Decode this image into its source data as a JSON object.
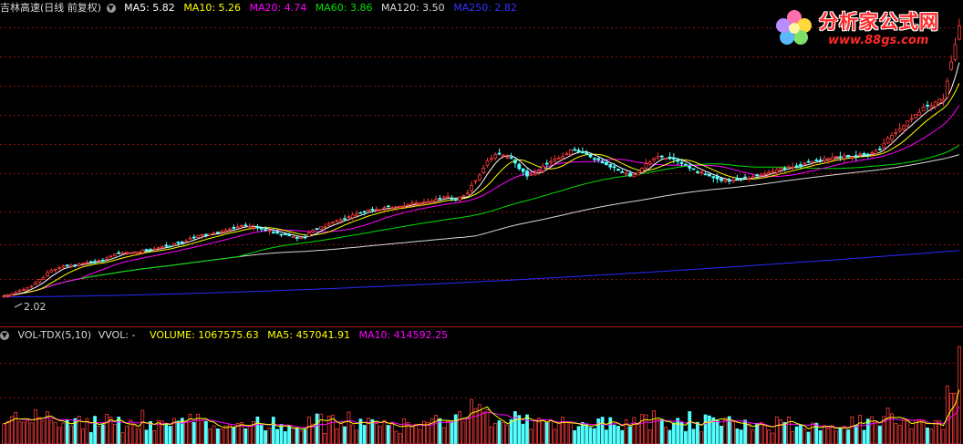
{
  "colors": {
    "up": "#ff3b3b",
    "down": "#54ffff",
    "ma5": "#ffffff",
    "ma10": "#ffff00",
    "ma20": "#ff00ff",
    "ma60": "#00e000",
    "ma120": "#d8d8d8",
    "ma250": "#2a2aff",
    "grid": "#8a1010"
  },
  "price_panel": {
    "title": "吉林高速(日线 前复权)",
    "indicators": [
      {
        "label": "MA5: 5.82",
        "color": "#ffffff"
      },
      {
        "label": "MA10: 5.26",
        "color": "#ffff00"
      },
      {
        "label": "MA20: 4.74",
        "color": "#ff00ff"
      },
      {
        "label": "MA60: 3.86",
        "color": "#00e000"
      },
      {
        "label": "MA120: 3.50",
        "color": "#d8d8d8"
      },
      {
        "label": "MA250: 2.82",
        "color": "#3333ff"
      }
    ],
    "low_marker": "2.02"
  },
  "volume_panel": {
    "title": "VOL-TDX(5,10)",
    "vvol": "VVOL: -",
    "indicators": [
      {
        "label": "VOLUME: 1067575.63",
        "color": "#ffff00"
      },
      {
        "label": "MA5: 457041.91",
        "color": "#ffffff"
      },
      {
        "label": "MA10: 414592.25",
        "color": "#ff00ff"
      }
    ]
  },
  "watermark": {
    "cn": "分析家公式网",
    "url": "www.88gs.com"
  },
  "chart_data": {
    "type": "candlestick",
    "symbol": "吉林高速",
    "period": "日线 前复权",
    "price_ylim": [
      1.8,
      7.0
    ],
    "anchors": [
      [
        0,
        2.02
      ],
      [
        8,
        2.25
      ],
      [
        18,
        2.55
      ],
      [
        26,
        2.65
      ],
      [
        32,
        2.78
      ],
      [
        44,
        2.9
      ],
      [
        52,
        3.1
      ],
      [
        62,
        3.25
      ],
      [
        72,
        3.1
      ],
      [
        76,
        3.05
      ],
      [
        82,
        3.25
      ],
      [
        92,
        3.5
      ],
      [
        100,
        3.6
      ],
      [
        112,
        3.75
      ],
      [
        118,
        3.75
      ],
      [
        126,
        4.55
      ],
      [
        132,
        4.45
      ],
      [
        138,
        4.15
      ],
      [
        150,
        4.6
      ],
      [
        166,
        4.15
      ],
      [
        174,
        4.5
      ],
      [
        190,
        4.05
      ],
      [
        200,
        4.15
      ],
      [
        208,
        4.3
      ],
      [
        218,
        4.45
      ],
      [
        230,
        4.5
      ],
      [
        238,
        4.55
      ],
      [
        246,
        5.05
      ],
      [
        252,
        5.35
      ],
      [
        258,
        5.5
      ],
      [
        260,
        6.8
      ]
    ],
    "closes": [
      2.02,
      2.02,
      2.05,
      2.08,
      2.11,
      2.13,
      2.16,
      2.19,
      2.25,
      2.31,
      2.34,
      2.43,
      2.47,
      2.49,
      2.52,
      2.55,
      2.55,
      2.56,
      2.56,
      2.58,
      2.6,
      2.61,
      2.62,
      2.63,
      2.65,
      2.64,
      2.69,
      2.72,
      2.76,
      2.78,
      2.78,
      2.79,
      2.78,
      2.79,
      2.79,
      2.83,
      2.83,
      2.84,
      2.85,
      2.87,
      2.89,
      2.91,
      2.9,
      2.95,
      2.96,
      2.97,
      2.99,
      3.04,
      3.06,
      3.09,
      3.1,
      3.1,
      3.11,
      3.13,
      3.14,
      3.16,
      3.18,
      3.2,
      3.22,
      3.24,
      3.26,
      3.27,
      3.25,
      3.23,
      3.22,
      3.2,
      3.18,
      3.18,
      3.14,
      3.13,
      3.11,
      3.1,
      3.08,
      3.07,
      3.04,
      3.05,
      3.06,
      3.13,
      3.18,
      3.21,
      3.24,
      3.24,
      3.3,
      3.33,
      3.35,
      3.37,
      3.38,
      3.42,
      3.45,
      3.47,
      3.49,
      3.51,
      3.54,
      3.54,
      3.55,
      3.55,
      3.58,
      3.6,
      3.58,
      3.6,
      3.6,
      3.61,
      3.64,
      3.66,
      3.67,
      3.66,
      3.68,
      3.69,
      3.7,
      3.73,
      3.74,
      3.77,
      3.78,
      3.74,
      3.71,
      3.77,
      3.8,
      3.84,
      3.97,
      4.06,
      4.16,
      4.28,
      4.41,
      4.45,
      4.52,
      4.53,
      4.51,
      4.48,
      4.45,
      4.37,
      4.27,
      4.22,
      4.14,
      4.17,
      4.19,
      4.24,
      4.32,
      4.36,
      4.4,
      4.44,
      4.46,
      4.49,
      4.54,
      4.6,
      4.6,
      4.57,
      4.55,
      4.53,
      4.48,
      4.44,
      4.43,
      4.37,
      4.34,
      4.3,
      4.29,
      4.24,
      4.21,
      4.19,
      4.14,
      4.17,
      4.21,
      4.28,
      4.36,
      4.39,
      4.45,
      4.49,
      4.48,
      4.46,
      4.45,
      4.44,
      4.4,
      4.36,
      4.34,
      4.28,
      4.26,
      4.21,
      4.21,
      4.17,
      4.14,
      4.11,
      4.09,
      4.06,
      4.07,
      4.05,
      4.07,
      4.09,
      4.1,
      4.11,
      4.1,
      4.13,
      4.15,
      4.16,
      4.18,
      4.21,
      4.22,
      4.25,
      4.28,
      4.28,
      4.3,
      4.3,
      4.32,
      4.34,
      4.37,
      4.39,
      4.4,
      4.42,
      4.41,
      4.45,
      4.45,
      4.47,
      4.49,
      4.47,
      4.5,
      4.49,
      4.47,
      4.49,
      4.53,
      4.51,
      4.52,
      4.55,
      4.59,
      4.62,
      4.71,
      4.81,
      4.86,
      4.91,
      4.98,
      5.03,
      5.12,
      5.16,
      5.23,
      5.27,
      5.36,
      5.38,
      5.39,
      5.45,
      5.5,
      5.5,
      5.82,
      6.16,
      6.47,
      6.8
    ],
    "ma_last": {
      "MA5": 5.82,
      "MA10": 5.26,
      "MA20": 4.74,
      "MA60": 3.86,
      "MA120": 3.5,
      "MA250": 2.82
    },
    "volume_ylim": [
      0,
      1100000
    ],
    "volume_last": {
      "VOLUME": 1067575.63,
      "MA5": 457041.91,
      "MA10": 414592.25
    }
  }
}
